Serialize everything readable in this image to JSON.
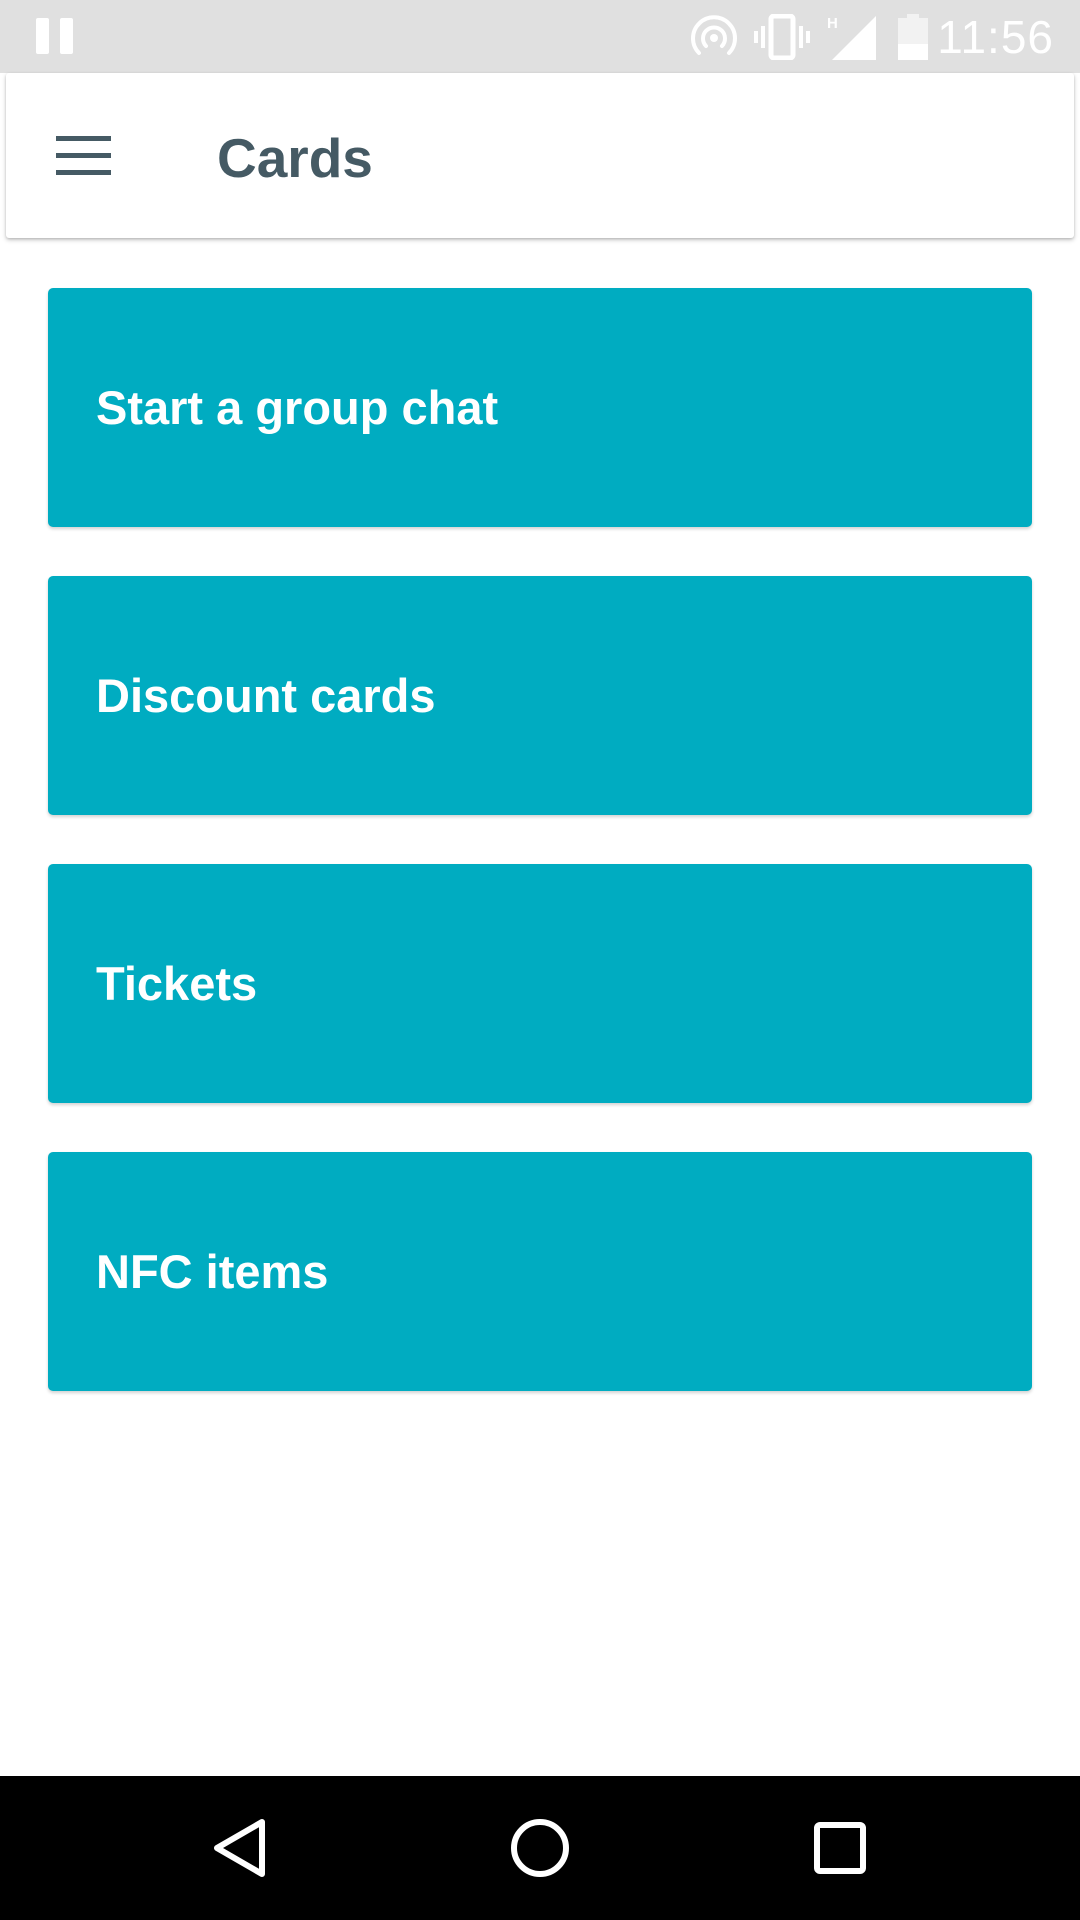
{
  "status_bar": {
    "time": "11:56",
    "network_type": "H",
    "icons": [
      "pause-icon",
      "hotspot-icon",
      "vibrate-icon",
      "signal-icon",
      "battery-icon"
    ]
  },
  "app_bar": {
    "title": "Cards",
    "menu_icon": "hamburger-menu-icon"
  },
  "cards": [
    {
      "label": "Start a group chat"
    },
    {
      "label": "Discount cards"
    },
    {
      "label": "Tickets"
    },
    {
      "label": "NFC items"
    }
  ],
  "nav_bar": {
    "icons": [
      "back-icon",
      "home-icon",
      "recents-icon"
    ]
  },
  "colors": {
    "status_bar_bg": "#e0e0e0",
    "app_bar_text": "#455a64",
    "card_bg": "#00acc1",
    "card_text": "#ffffff",
    "nav_bar_bg": "#000000"
  }
}
